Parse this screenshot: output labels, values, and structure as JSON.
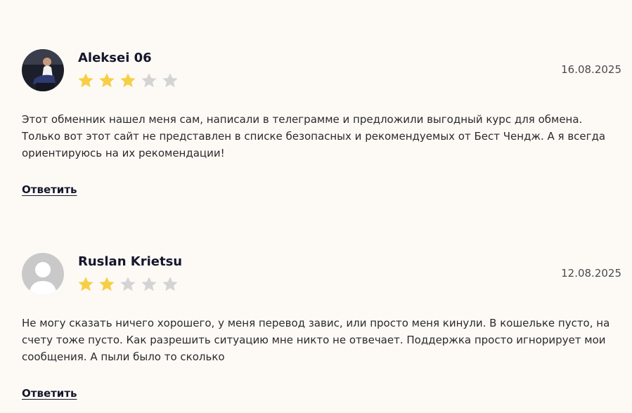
{
  "colors": {
    "background": "#fdfaf6",
    "star_filled": "#f7cf45",
    "star_empty": "#d4d4d4",
    "name": "#15172b"
  },
  "reviews": [
    {
      "author": "Aleksei 06",
      "date": "16.08.2025",
      "rating": 3,
      "max_rating": 5,
      "text": "Этот обменник нашел меня сам, написали в телеграмме и предложили выгодный курс для обмена. Только вот этот сайт не представлен в списке безопасных и рекомендуемых от Бест Чендж. А я всегда ориентируюсь на их рекомендации!",
      "reply_label": "Ответить",
      "avatar": "user-photo-icon"
    },
    {
      "author": "Ruslan Krietsu",
      "date": "12.08.2025",
      "rating": 2,
      "max_rating": 5,
      "text": "Не могу сказать ничего хорошего, у меня перевод завис, или просто меня кинули. В кошельке пусто, на счету тоже пусто. Как разрешить ситуацию мне никто не отвечает. Поддержка просто игнорирует мои сообщения. А пыли было то сколько",
      "reply_label": "Ответить",
      "avatar": "default-user-icon"
    }
  ]
}
